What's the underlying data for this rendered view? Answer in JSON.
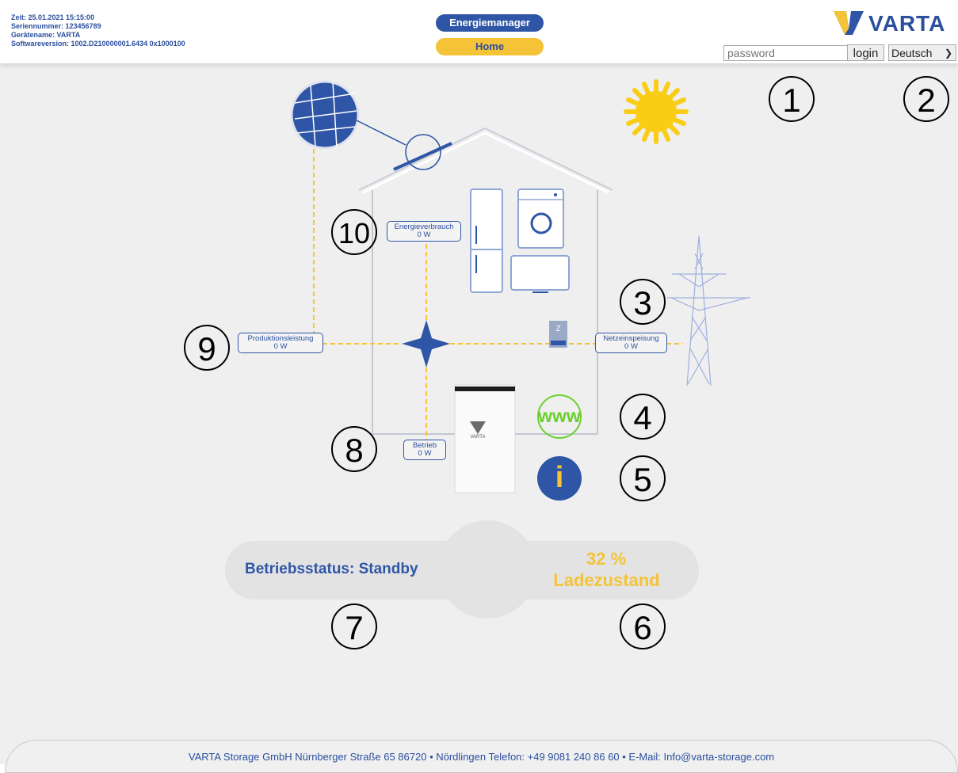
{
  "header": {
    "zeit": "Zeit: 25.01.2021 15:15:00",
    "seriennummer": "Seriennummer: 123456789",
    "geraetename": "Gerätename: VARTA",
    "softwareversion": "Softwareversion: 1002.D210000001.6434 0x1000100",
    "nav_energiemanager": "Energiemanager",
    "nav_home": "Home",
    "brand": "VARTA",
    "password_placeholder": "password",
    "login_label": "login",
    "language": "Deutsch"
  },
  "diagram": {
    "energieverbrauch": {
      "label": "Energieverbrauch",
      "value": "0 W"
    },
    "produktionsleistung": {
      "label": "Produktionsleistung",
      "value": "0 W"
    },
    "netzeinspeisung": {
      "label": "Netzeinspeisung",
      "value": "0 W"
    },
    "betrieb": {
      "label": "Betrieb",
      "value": "0 W"
    },
    "battery_brand": "VARTA",
    "meter_letter": "Z",
    "www_label": "www",
    "info_label": "i"
  },
  "status": {
    "betriebsstatus": "Betriebsstatus: Standby",
    "soc_value": "32 %",
    "soc_fraction": 0.32,
    "soc_label": "Ladezustand"
  },
  "annotations": [
    "1",
    "2",
    "3",
    "4",
    "5",
    "6",
    "7",
    "8",
    "9",
    "10"
  ],
  "colors": {
    "brand_blue": "#2f56a6",
    "brand_yellow": "#f5c338",
    "flow_line": "#f5c338",
    "www_green": "#6ccf2e"
  },
  "footer": {
    "text": "VARTA Storage GmbH Nürnberger Straße 65 86720 • Nördlingen Telefon: +49 9081 240 86 60 • E-Mail: Info@varta-storage.com"
  }
}
